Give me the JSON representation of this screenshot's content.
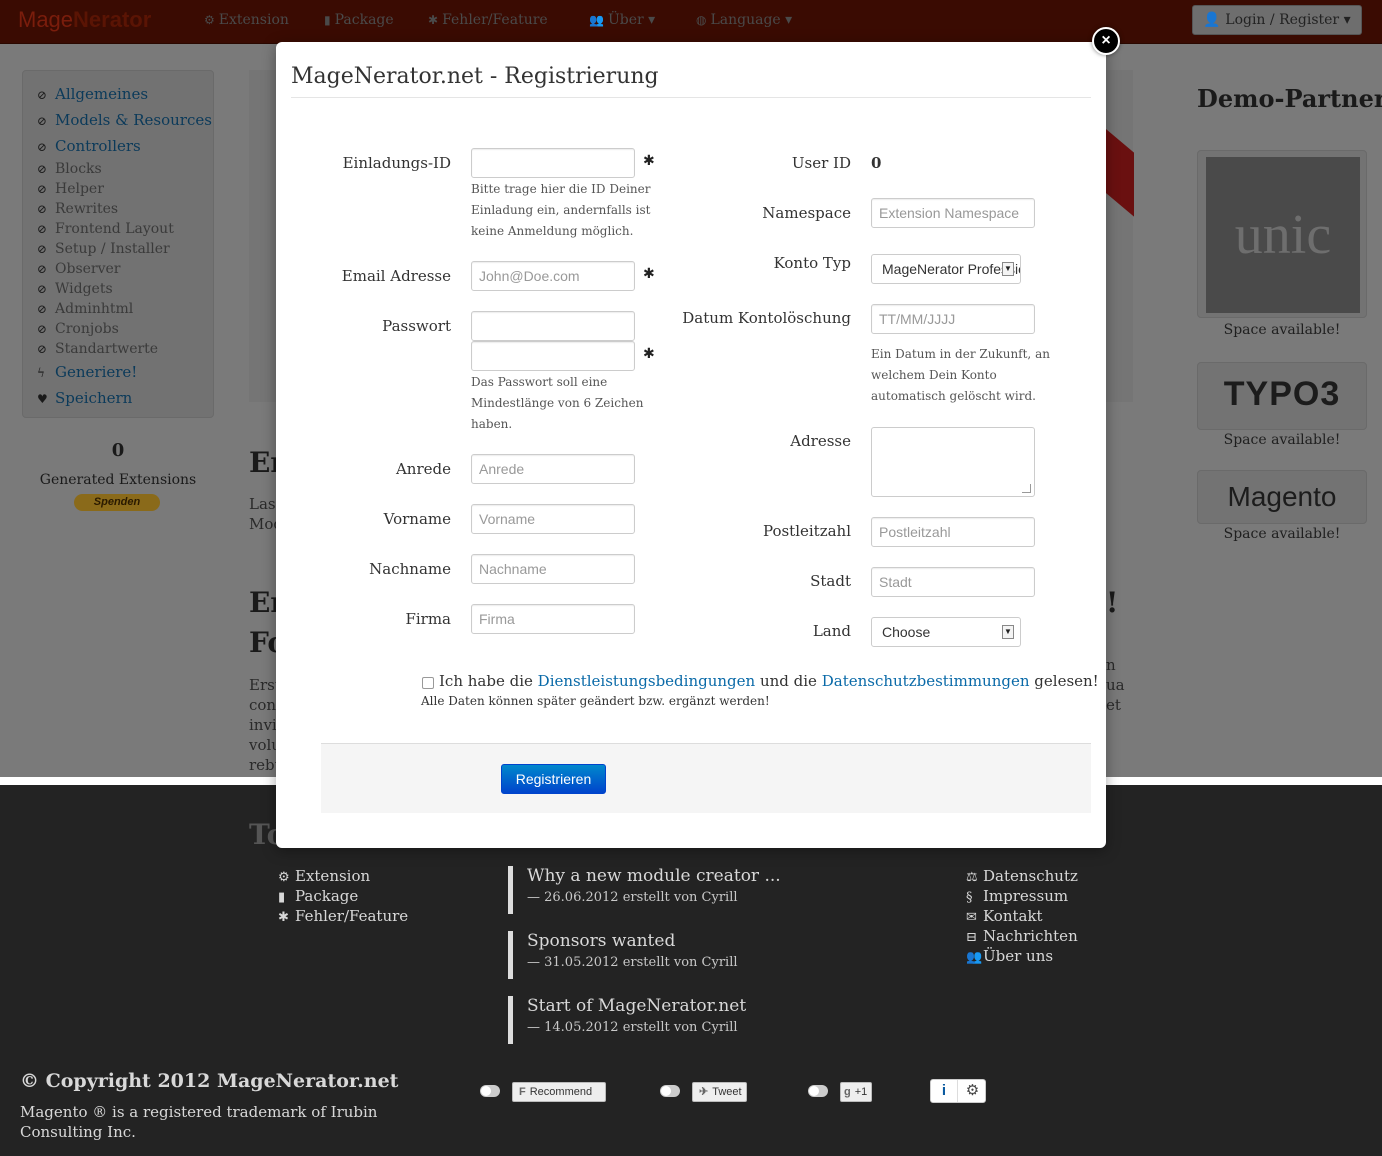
{
  "navbar": {
    "brand_part1": "Mage",
    "brand_part2": "Nerator",
    "items": [
      {
        "icon": "wrench-icon",
        "glyph": "⚙",
        "label": "Extension"
      },
      {
        "icon": "package-icon",
        "glyph": "▮",
        "label": "Package"
      },
      {
        "icon": "bug-icon",
        "glyph": "✱",
        "label": "Fehler/Feature"
      },
      {
        "icon": "users-icon",
        "glyph": "👥",
        "label": "Über"
      },
      {
        "icon": "globe-icon",
        "glyph": "◍",
        "label": "Language"
      }
    ],
    "login_label": "Login / Register"
  },
  "sidebar": {
    "items": [
      {
        "label": "Allgemeines",
        "glyph": "⊘"
      },
      {
        "label": "Models & Resources",
        "glyph": "⊘"
      },
      {
        "label": "Controllers",
        "glyph": "⊘"
      },
      {
        "label": "Blocks",
        "glyph": "⊘"
      },
      {
        "label": "Helper",
        "glyph": "⊘"
      },
      {
        "label": "Rewrites",
        "glyph": "⊘"
      },
      {
        "label": "Frontend Layout",
        "glyph": "⊘"
      },
      {
        "label": "Setup / Installer",
        "glyph": "⊘"
      },
      {
        "label": "Observer",
        "glyph": "⊘"
      },
      {
        "label": "Widgets",
        "glyph": "⊘"
      },
      {
        "label": "Adminhtml",
        "glyph": "⊘"
      },
      {
        "label": "Cronjobs",
        "glyph": "⊘"
      },
      {
        "label": "Standartwerte",
        "glyph": "⊘"
      },
      {
        "label": "Generiere!",
        "glyph": "ϟ"
      },
      {
        "label": "Speichern",
        "glyph": "♥"
      }
    ],
    "generated_count": "0",
    "generated_label": "Generated Extensions",
    "donate_label": "Spenden"
  },
  "main_fragments": {
    "heading1": "Er",
    "text1a": "Lass",
    "text1b": "Mod",
    "heading2a": "Er",
    "heading2b": "Fo",
    "heading2_end": "!",
    "text2": [
      "Erst",
      "con",
      "invi",
      "volu",
      "rebu"
    ],
    "right_frag": [
      "n",
      "ua",
      "et"
    ]
  },
  "demo_partner": {
    "title": "Demo-Partner",
    "partners": [
      {
        "name": "unic",
        "status": "Space available!"
      },
      {
        "name": "TYPO3",
        "status": "Space available!"
      },
      {
        "name": "Magento",
        "status": "Space available!"
      }
    ]
  },
  "modal": {
    "title": "MageNerator.net - Registrierung",
    "close_glyph": "×",
    "left_fields": {
      "invite": {
        "label": "Einladungs-ID",
        "value": "",
        "placeholder": "",
        "help": [
          "Bitte trage hier die ID Deiner",
          "Einladung ein, andernfalls ist",
          "keine Anmeldung möglich."
        ]
      },
      "email": {
        "label": "Email Adresse",
        "placeholder": "John@Doe.com"
      },
      "password": {
        "label": "Passwort",
        "placeholder": "",
        "help": [
          "Das Passwort soll eine",
          "Mindestlänge von 6 Zeichen",
          "haben."
        ]
      },
      "salutation": {
        "label": "Anrede",
        "placeholder": "Anrede"
      },
      "firstname": {
        "label": "Vorname",
        "placeholder": "Vorname"
      },
      "lastname": {
        "label": "Nachname",
        "placeholder": "Nachname"
      },
      "company": {
        "label": "Firma",
        "placeholder": "Firma"
      }
    },
    "required_glyph": "✱",
    "right_fields": {
      "user_id": {
        "label": "User ID",
        "value": "0"
      },
      "namespace": {
        "label": "Namespace",
        "placeholder": "Extension Namespace"
      },
      "account_type": {
        "label": "Konto Typ",
        "selected": "MageNerator Professional"
      },
      "deletion_date": {
        "label": "Datum Kontolöschung",
        "placeholder": "TT/MM/JJJJ",
        "help": [
          "Ein Datum in der Zukunft, an",
          "welchem Dein Konto",
          "automatisch gelöscht wird."
        ]
      },
      "address": {
        "label": "Adresse"
      },
      "zip": {
        "label": "Postleitzahl",
        "placeholder": "Postleitzahl"
      },
      "city": {
        "label": "Stadt",
        "placeholder": "Stadt"
      },
      "country": {
        "label": "Land",
        "selected": "Choose"
      }
    },
    "terms": {
      "prefix": "Ich habe die",
      "terms_link": "Dienstleistungsbedingungen",
      "middle": "und die",
      "privacy_link": "Datenschutzbestimmungen",
      "suffix": "gelesen!",
      "note": "Alle Daten können später geändert bzw. ergänzt werden!"
    },
    "submit_label": "Registrieren"
  },
  "footer": {
    "heading_frag": "To",
    "links": [
      {
        "glyph": "⚙",
        "label": "Extension"
      },
      {
        "glyph": "▮",
        "label": "Package"
      },
      {
        "glyph": "✱",
        "label": "Fehler/Feature"
      }
    ],
    "news": [
      {
        "title": "Why a new module creator ...",
        "meta": "— 26.06.2012 erstellt von Cyrill"
      },
      {
        "title": "Sponsors wanted",
        "meta": "— 31.05.2012 erstellt von Cyrill"
      },
      {
        "title": "Start of MageNerator.net",
        "meta": "— 14.05.2012 erstellt von Cyrill"
      }
    ],
    "right_links": [
      {
        "glyph": "⚖",
        "label": "Datenschutz"
      },
      {
        "glyph": "§",
        "label": "Impressum"
      },
      {
        "glyph": "✉",
        "label": "Kontakt"
      },
      {
        "glyph": "⊟",
        "label": "Nachrichten"
      },
      {
        "glyph": "👥",
        "label": "Über uns"
      }
    ],
    "copyright": "© Copyright 2012 MageNerator.net",
    "trademark": "Magento ® is a registered trademark of Irubin Consulting Inc.",
    "social": {
      "facebook": {
        "glyph": "F",
        "label": "Recommend"
      },
      "twitter": {
        "glyph": "✈",
        "label": "Tweet"
      },
      "google": {
        "glyph": "g",
        "label": "+1"
      }
    },
    "info_glyph": "i",
    "settings_glyph": "⚙"
  }
}
